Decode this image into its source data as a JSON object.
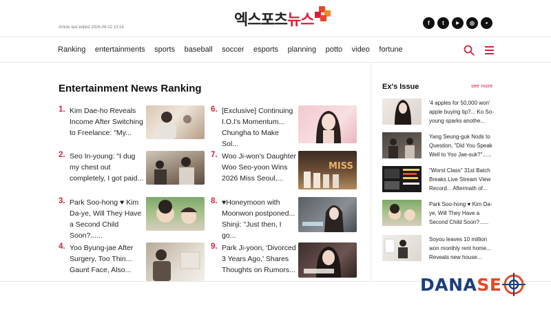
{
  "header": {
    "edited_text": "Article last edited 2026-06-02 13:14",
    "logo_dark": "엑스포츠",
    "logo_red": "뉴스",
    "logo_colors": [
      "#e8452c",
      "#f08a24",
      "#d6213a",
      "#f5a623"
    ],
    "socials": [
      {
        "icon": "facebook-icon",
        "glyph": "f"
      },
      {
        "icon": "twitter-icon",
        "glyph": "t"
      },
      {
        "icon": "youtube-icon",
        "glyph": "▶"
      },
      {
        "icon": "instagram-icon",
        "glyph": "◎"
      },
      {
        "icon": "kakao-icon",
        "glyph": "●"
      }
    ]
  },
  "nav": {
    "items": [
      "Ranking",
      "entertainments",
      "sports",
      "baseball",
      "soccer",
      "esports",
      "planning",
      "potto",
      "video",
      "fortune"
    ],
    "search_icon": "search-icon",
    "menu_icon": "hamburger-menu-icon",
    "accent": "#d6213a"
  },
  "ranking": {
    "title": "Entertainment News Ranking",
    "items": [
      {
        "num": "1.",
        "text": "Kim Dae-ho Reveals Income After Switching to Freelance: \"My..."
      },
      {
        "num": "2.",
        "text": "Seo In-young: \"I dug my chest out completely, I got paid..."
      },
      {
        "num": "3.",
        "text": "Park Soo-hong ♥ Kim Da-ye, Will They Have a Second Child Soon?......"
      },
      {
        "num": "4.",
        "text": "Yoo Byung-jae After Surgery, Too Thin... Gaunt Face, Also..."
      },
      {
        "num": "6.",
        "text": "[Exclusive] Continuing I.O.I's Momentum... Chungha to Make Sol..."
      },
      {
        "num": "7.",
        "text": "Woo Ji-won's Daughter Woo Seo-yoon Wins 2026 Miss Seoul,..."
      },
      {
        "num": "8.",
        "text": "♥Honeymoon with Moonwon postponed... Shinji: \"Just then, I go..."
      },
      {
        "num": "9.",
        "text": "Park Ji-yoon, 'Divorced 3 Years Ago,' Shares Thoughts on Rumors..."
      }
    ],
    "thumb7_text": "MISS KO"
  },
  "issue": {
    "title": "Ex's Issue",
    "see_more": "see more",
    "items": [
      {
        "text": "'4 apples for 50,000 won' apple buying tip?... Ko So-young sparks anothe..."
      },
      {
        "text": "Yang Seung-guk Nods to Question, \"Did You Speak Well to Yoo Jae-suk?\"......"
      },
      {
        "text": "\"Worst Class\" 31st Batch Breaks Live Stream View Record... Aftermath of..."
      },
      {
        "text": "Park Soo-hong ♥ Kim Da-ye, Will They Have a Second Child Soon?......"
      },
      {
        "text": "Soyou leaves 10 million won monthly rent home... Reveals new house..."
      }
    ]
  },
  "watermark": {
    "part1": "DANA",
    "part2": "SE",
    "colors": {
      "navy": "#1d3e7a",
      "orange": "#e24a2a"
    }
  }
}
